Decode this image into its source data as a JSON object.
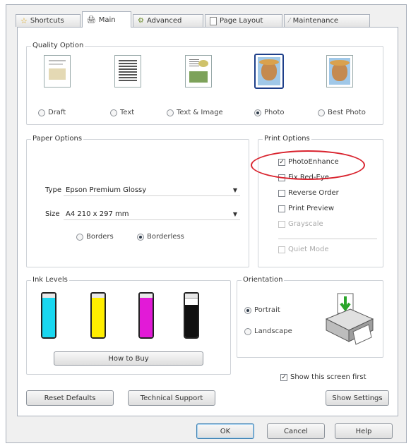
{
  "tabs": [
    {
      "label": "Shortcuts",
      "icon": "star-icon"
    },
    {
      "label": "Main",
      "icon": "printer-icon",
      "active": true
    },
    {
      "label": "Advanced",
      "icon": "gear-icon"
    },
    {
      "label": "Page Layout",
      "icon": "page-icon"
    },
    {
      "label": "Maintenance",
      "icon": "wrench-icon"
    }
  ],
  "quality": {
    "title": "Quality Option",
    "options": [
      "Draft",
      "Text",
      "Text & Image",
      "Photo",
      "Best Photo"
    ],
    "selected": "Photo"
  },
  "paper": {
    "title": "Paper Options",
    "type_label": "Type",
    "type_value": "Epson Premium Glossy",
    "size_label": "Size",
    "size_value": "A4 210 x 297 mm",
    "borders_label": "Borders",
    "borderless_label": "Borderless",
    "selected": "Borderless"
  },
  "print_options": {
    "title": "Print Options",
    "items": [
      {
        "label": "PhotoEnhance",
        "checked": true,
        "enabled": true,
        "highlighted": true
      },
      {
        "label": "Fix Red-Eye",
        "checked": false,
        "enabled": true
      },
      {
        "label": "Reverse Order",
        "checked": false,
        "enabled": true
      },
      {
        "label": "Print Preview",
        "checked": false,
        "enabled": true
      },
      {
        "label": "Grayscale",
        "checked": false,
        "enabled": false
      },
      {
        "label": "Quiet Mode",
        "checked": false,
        "enabled": false
      }
    ],
    "highlight_color": "#d9232e"
  },
  "ink": {
    "title": "Ink Levels",
    "cartridges": [
      {
        "color": "#19d7f0",
        "level": 0.9
      },
      {
        "color": "#ffee00",
        "level": 0.9
      },
      {
        "color": "#e21ad7",
        "level": 0.9
      },
      {
        "color": "#111111",
        "level": 0.75
      }
    ],
    "how_to_buy": "How to Buy"
  },
  "orientation": {
    "title": "Orientation",
    "portrait": "Portrait",
    "landscape": "Landscape",
    "selected": "Portrait"
  },
  "show_first": {
    "label": "Show this screen first",
    "checked": true
  },
  "buttons": {
    "reset": "Reset Defaults",
    "support": "Technical Support",
    "settings": "Show Settings",
    "ok": "OK",
    "cancel": "Cancel",
    "help": "Help"
  }
}
